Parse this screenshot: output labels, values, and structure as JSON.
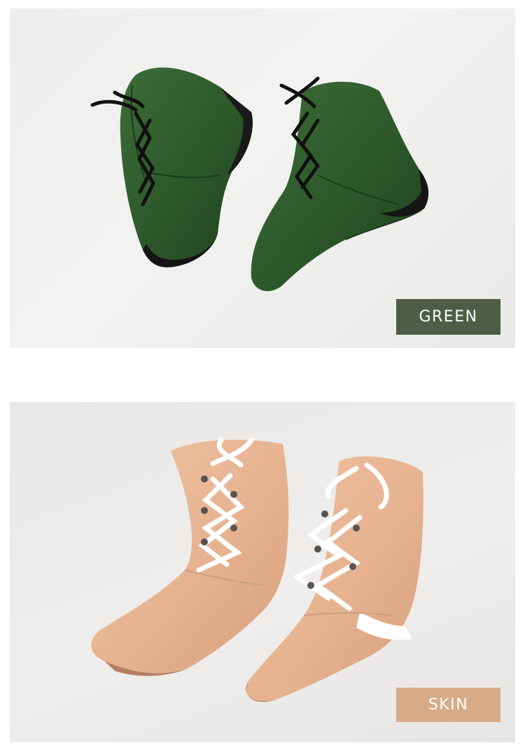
{
  "variants": [
    {
      "label": "GREEN",
      "swatch": "#4e5e44",
      "boot_color": "#2f5a2e",
      "lace_color": "#111111"
    },
    {
      "label": "SKIN",
      "swatch": "#d7aa88",
      "boot_color": "#e8b796",
      "lace_color": "#ffffff"
    }
  ]
}
